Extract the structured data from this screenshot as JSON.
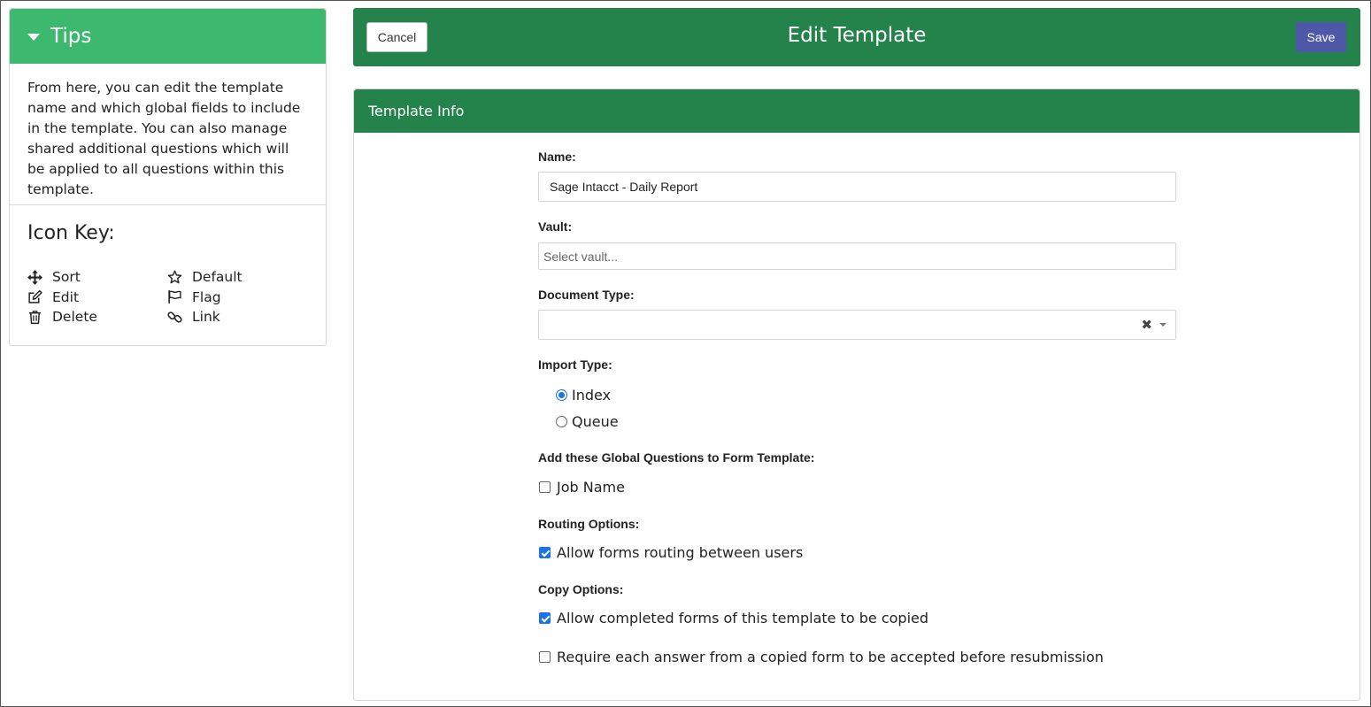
{
  "tips": {
    "title": "Tips",
    "body": "From here, you can edit the template name and which global fields to include in the template. You can also manage shared additional questions which will be applied to all questions within this template.",
    "icon_key_title": "Icon Key:",
    "icon_key": [
      {
        "label": "Sort",
        "icon": "move-arrows-icon"
      },
      {
        "label": "Default",
        "icon": "star-icon"
      },
      {
        "label": "Edit",
        "icon": "edit-icon"
      },
      {
        "label": "Flag",
        "icon": "flag-icon"
      },
      {
        "label": "Delete",
        "icon": "trash-icon"
      },
      {
        "label": "Link",
        "icon": "link-icon"
      }
    ]
  },
  "header": {
    "cancel_label": "Cancel",
    "title": "Edit Template",
    "save_label": "Save"
  },
  "template_info": {
    "section_title": "Template Info",
    "name_label": "Name:",
    "name_value": "Sage Intacct - Daily Report",
    "vault_label": "Vault:",
    "vault_placeholder": "Select vault...",
    "doc_type_label": "Document Type:",
    "doc_type_value": "",
    "import_type_label": "Import Type:",
    "import_options": [
      {
        "label": "Index",
        "selected": true
      },
      {
        "label": "Queue",
        "selected": false
      }
    ],
    "global_questions_label": "Add these Global Questions to Form Template:",
    "global_questions": [
      {
        "label": "Job Name",
        "checked": false
      }
    ],
    "routing_label": "Routing Options:",
    "routing_options": [
      {
        "label": "Allow forms routing between users",
        "checked": true
      }
    ],
    "copy_label": "Copy Options:",
    "copy_options": [
      {
        "label": "Allow completed forms of this template to be copied",
        "checked": true
      },
      {
        "label": "Require each answer from a copied form to be accepted before resubmission",
        "checked": false
      }
    ]
  },
  "colors": {
    "tips_header": "#3cb96e",
    "header_green": "#24824b",
    "save_button": "#4e57a8",
    "checkbox_blue": "#1a73e8"
  }
}
